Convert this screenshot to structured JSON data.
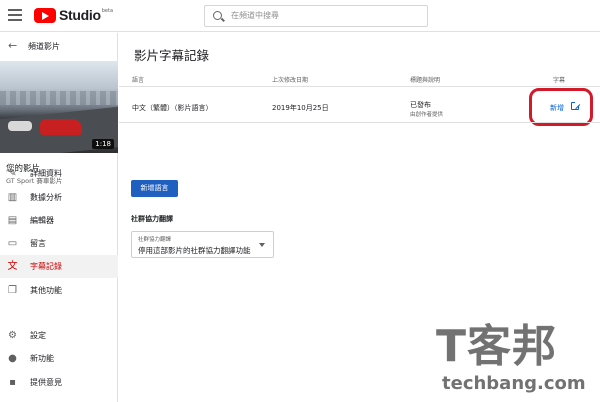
{
  "topbar": {
    "logo_text": "Studio",
    "logo_badge": "beta",
    "search_placeholder": "在頻道中搜尋"
  },
  "sidebar": {
    "back_label": "頻道影片",
    "video_duration": "1:18",
    "your_video_label": "您的影片",
    "video_title": "GT Sport 賽車影片",
    "items": [
      {
        "label": "詳細資料",
        "icon": "pencil-icon"
      },
      {
        "label": "數據分析",
        "icon": "bar-chart-icon"
      },
      {
        "label": "編輯器",
        "icon": "film-icon"
      },
      {
        "label": "留言",
        "icon": "comment-icon"
      },
      {
        "label": "字幕記錄",
        "icon": "translate-icon",
        "active": true
      },
      {
        "label": "其他功能",
        "icon": "copy-icon"
      },
      {
        "label": "設定",
        "icon": "gear-icon"
      },
      {
        "label": "新功能",
        "icon": "alert-icon"
      },
      {
        "label": "提供意見",
        "icon": "feedback-icon"
      }
    ]
  },
  "main": {
    "title": "影片字幕記錄",
    "table": {
      "headers": [
        "語言",
        "上次修改日期",
        "標題與說明",
        "字幕"
      ],
      "rows": [
        {
          "language": "中文（繁體）（影片語言）",
          "modified": "2019年10月25日",
          "status": "已發布",
          "status_sub": "由創作者提供",
          "action": "新增"
        }
      ]
    },
    "add_language_button": "新增語言",
    "community": {
      "title": "社群協力翻譯",
      "field_label": "社群協力翻譯",
      "field_value": "停用這部影片的社群協力翻譯功能"
    }
  },
  "watermark": {
    "big": "T客邦",
    "small": "techbang.com"
  },
  "colors": {
    "accent": "#cc0000",
    "link": "#065fd4",
    "button": "#1f5fbf",
    "highlight": "#d21a2a"
  }
}
